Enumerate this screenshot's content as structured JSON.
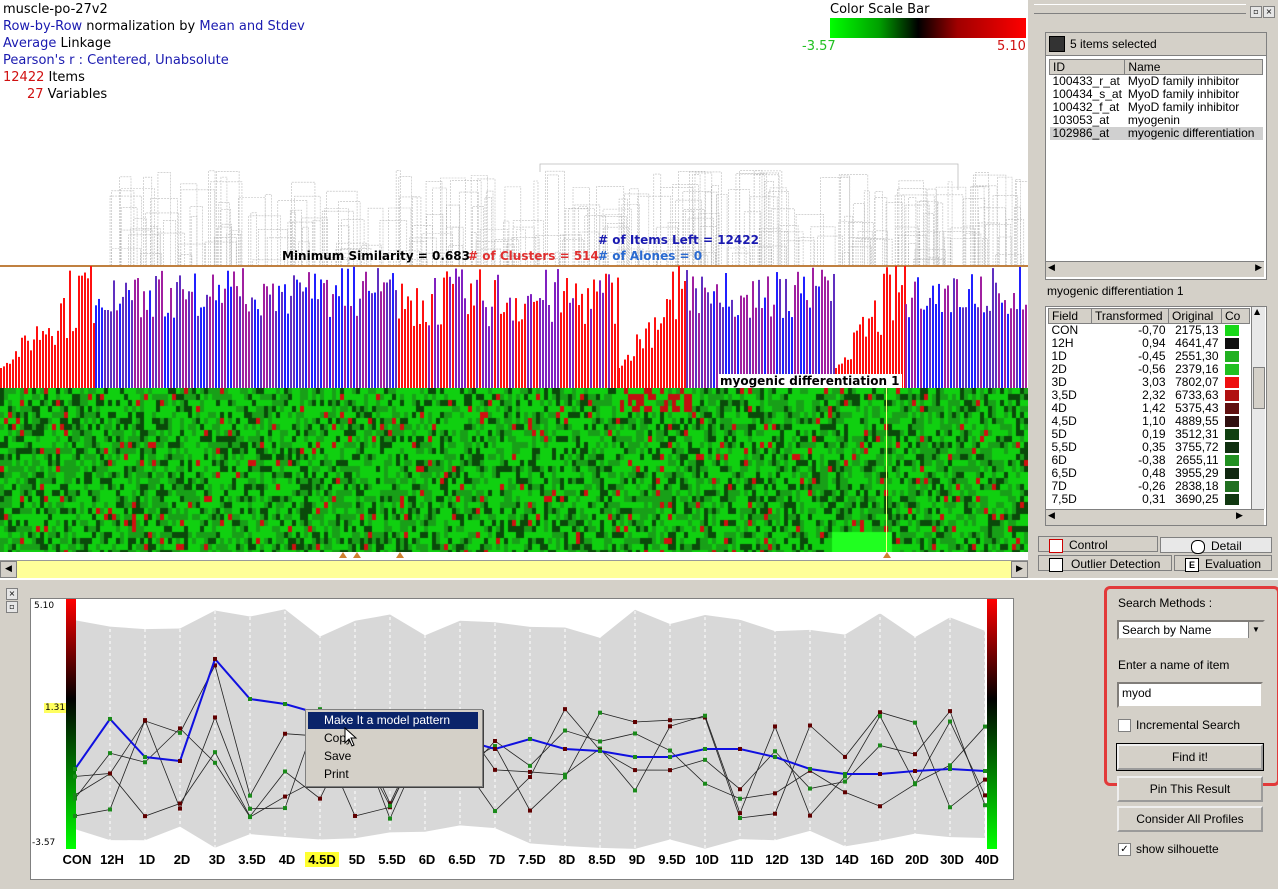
{
  "info": {
    "dataset": "muscle-po-27v2",
    "normalization": [
      "Row-by-Row",
      " normalization by ",
      "Mean and Stdev"
    ],
    "linkage": [
      "Average",
      " Linkage"
    ],
    "similarity": "Pearson's r : Centered, Unabsolute",
    "items_count": "12422",
    "items_label": " Items",
    "vars_count": "27",
    "vars_label": " Variables"
  },
  "color_scale": {
    "title": "Color Scale Bar",
    "min": "-3.57",
    "max": "5.10",
    "low_color": "#00ff00",
    "high_color": "#ff0000"
  },
  "cluster_stats": {
    "min_similarity": "Minimum Similarity = 0.683",
    "clusters": "# of Clusters = 514",
    "items_left": "# of Items Left = 12422",
    "alones": "# of Alones = 0"
  },
  "heatmap_label": "myogenic differentiation 1",
  "selection": {
    "header": "5 items selected",
    "columns": [
      "ID",
      "Name"
    ],
    "rows": [
      [
        "100433_r_at",
        "MyoD family inhibitor"
      ],
      [
        "100434_s_at",
        "MyoD family inhibitor"
      ],
      [
        "100432_f_at",
        "MyoD family inhibitor"
      ],
      [
        "103053_at",
        "myogenin"
      ],
      [
        "102986_at",
        "myogenic differentiation"
      ]
    ]
  },
  "detail": {
    "title": "myogenic differentiation 1",
    "columns": [
      "Field",
      "Transformed",
      "Original",
      "Co"
    ],
    "rows": [
      [
        "CON",
        "-0,70",
        "2175,13",
        "#18d818"
      ],
      [
        "12H",
        "0,94",
        "4641,47",
        "#101010"
      ],
      [
        "1D",
        "-0,45",
        "2551,30",
        "#20b020"
      ],
      [
        "2D",
        "-0,56",
        "2379,16",
        "#20c020"
      ],
      [
        "3D",
        "3,03",
        "7802,07",
        "#ee1010"
      ],
      [
        "3,5D",
        "2,32",
        "6733,63",
        "#b01010"
      ],
      [
        "4D",
        "1,42",
        "5375,43",
        "#601010"
      ],
      [
        "4,5D",
        "1,10",
        "4889,55",
        "#301010"
      ],
      [
        "5D",
        "0,19",
        "3512,31",
        "#104010"
      ],
      [
        "5,5D",
        "0,35",
        "3755,72",
        "#103010"
      ],
      [
        "6D",
        "-0,38",
        "2655,11",
        "#209020"
      ],
      [
        "6,5D",
        "0,48",
        "3955,29",
        "#102810"
      ],
      [
        "7D",
        "-0,26",
        "2838,18",
        "#207020"
      ],
      [
        "7,5D",
        "0,31",
        "3690,25",
        "#103810"
      ]
    ]
  },
  "tabs": {
    "control": "Control",
    "detail": "Detail",
    "outlier": "Outlier Detection",
    "evaluation": "Evaluation"
  },
  "profile": {
    "ymax": "5.10",
    "ymid": "1.31",
    "ymin": "-3.57",
    "columns": [
      "CON",
      "12H",
      "1D",
      "2D",
      "3D",
      "3.5D",
      "4D",
      "4.5D",
      "5D",
      "5.5D",
      "6D",
      "6.5D",
      "7D",
      "7.5D",
      "8D",
      "8.5D",
      "9D",
      "9.5D",
      "10D",
      "11D",
      "12D",
      "13D",
      "14D",
      "16D",
      "20D",
      "30D",
      "40D"
    ],
    "highlighted_column": "4.5D"
  },
  "context_menu": {
    "items": [
      "Make It a model pattern",
      "Copy",
      "Save",
      "Print"
    ]
  },
  "search": {
    "methods_label": "Search Methods :",
    "method_value": "Search by Name",
    "enter_label": "Enter a name of item",
    "query": "myod",
    "incremental_label": "Incremental Search",
    "incremental_checked": false,
    "find_label": "Find it!"
  },
  "buttons": {
    "pin": "Pin This Result",
    "consider": "Consider All Profiles",
    "silhouette_label": "show silhouette",
    "silhouette_checked": true
  }
}
